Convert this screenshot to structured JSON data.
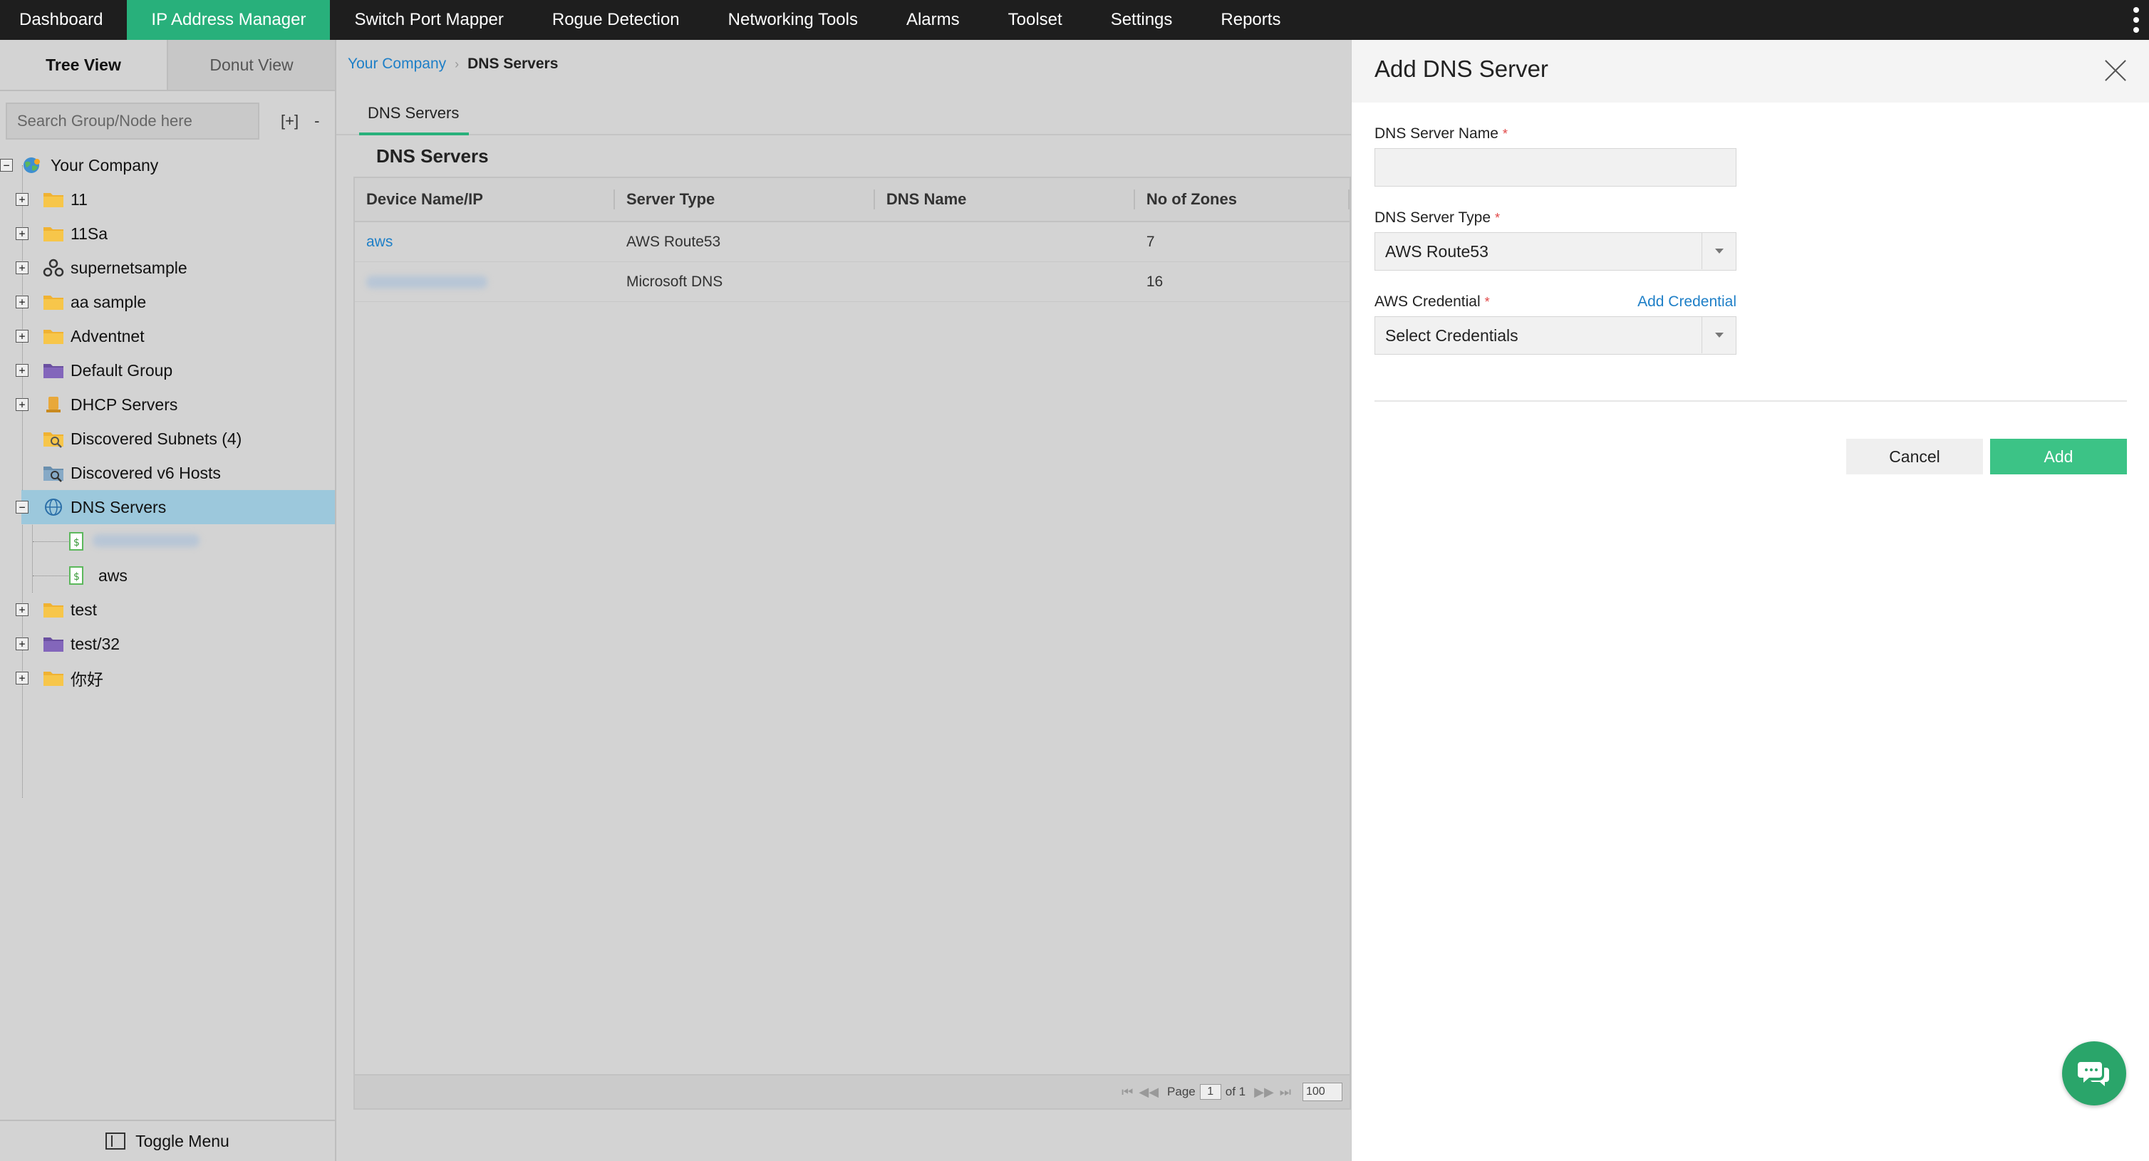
{
  "topnav": {
    "items": [
      {
        "label": "Dashboard"
      },
      {
        "label": "IP Address Manager",
        "active": true
      },
      {
        "label": "Switch Port Mapper"
      },
      {
        "label": "Rogue Detection"
      },
      {
        "label": "Networking Tools"
      },
      {
        "label": "Alarms"
      },
      {
        "label": "Toolset"
      },
      {
        "label": "Settings"
      },
      {
        "label": "Reports"
      }
    ],
    "accent_color": "#28b07b"
  },
  "sidebar": {
    "tabs": {
      "tree": "Tree View",
      "donut": "Donut View"
    },
    "search_placeholder": "Search Group/Node here",
    "expand_all": "[+]",
    "collapse_all": "-",
    "tree": {
      "root": "Your Company",
      "items": [
        {
          "label": "11",
          "icon": "folder-icon"
        },
        {
          "label": "11Sa",
          "icon": "folder-icon"
        },
        {
          "label": "supernetsample",
          "icon": "supernet-icon"
        },
        {
          "label": "aa sample",
          "icon": "folder-icon"
        },
        {
          "label": "Adventnet",
          "icon": "folder-icon"
        },
        {
          "label": "Default Group",
          "icon": "purple-folder-icon"
        },
        {
          "label": "DHCP Servers",
          "icon": "dhcp-server-icon"
        },
        {
          "label": "Discovered Subnets (4)",
          "icon": "discovered-subnets-icon"
        },
        {
          "label": "Discovered v6 Hosts",
          "icon": "discovered-hosts-icon"
        },
        {
          "label": "DNS Servers",
          "icon": "globe-icon",
          "selected": true
        },
        {
          "label": "aws",
          "icon": "dns-node-icon"
        },
        {
          "label": "test",
          "icon": "folder-icon"
        },
        {
          "label": "test/32",
          "icon": "purple-folder-icon"
        },
        {
          "label": "你好",
          "icon": "folder-icon"
        }
      ]
    },
    "toggle_menu": "Toggle Menu"
  },
  "main": {
    "breadcrumb": {
      "root": "Your Company",
      "current": "DNS Servers"
    },
    "sub_tab": "DNS Servers",
    "heading": "DNS Servers",
    "table": {
      "columns": [
        "Device Name/IP",
        "Server Type",
        "DNS Name",
        "No of Zones"
      ],
      "rows": [
        {
          "name": "aws",
          "type": "AWS Route53",
          "dns_name": "",
          "zones": "7"
        },
        {
          "name": "",
          "type": "Microsoft DNS",
          "dns_name": "",
          "zones": "16"
        }
      ]
    },
    "pager": {
      "page_label": "Page",
      "page": "1",
      "of": "of 1",
      "page_size": "100"
    }
  },
  "panel": {
    "title": "Add DNS Server",
    "server_name": {
      "label": "DNS Server Name",
      "required": "*",
      "value": ""
    },
    "server_type": {
      "label": "DNS Server Type",
      "required": "*",
      "value": "AWS Route53"
    },
    "credential": {
      "label": "AWS Credential",
      "required": "*",
      "value": "Select Credentials",
      "add_link": "Add Credential"
    },
    "cancel": "Cancel",
    "add": "Add",
    "add_color": "#3cc386"
  }
}
